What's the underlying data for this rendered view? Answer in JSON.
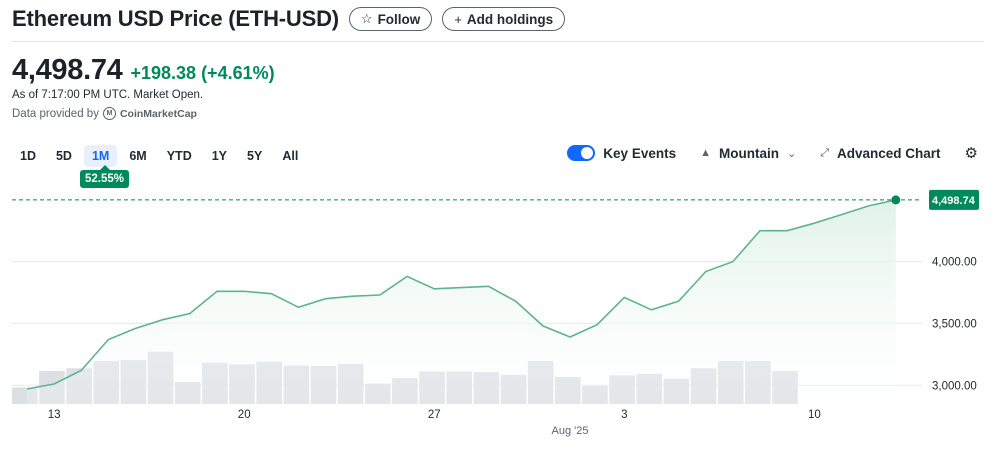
{
  "header": {
    "title": "Ethereum USD Price (ETH-USD)",
    "follow_label": "Follow",
    "add_holdings_label": "Add holdings"
  },
  "quote": {
    "price": "4,498.74",
    "change": "+198.38 (+4.61%)",
    "as_of": "As of 7:17:00 PM UTC. Market Open.",
    "provided_by": "Data provided by",
    "provider": "CoinMarketCap"
  },
  "ranges": [
    "1D",
    "5D",
    "1M",
    "6M",
    "YTD",
    "1Y",
    "5Y",
    "All"
  ],
  "active_range": "1M",
  "range_change_badge": "52.55%",
  "controls": {
    "key_events_label": "Key Events",
    "key_events_on": true,
    "chart_type_label": "Mountain",
    "advanced_label": "Advanced Chart"
  },
  "icons": {
    "follow": "star-outline-icon",
    "add": "plus-icon",
    "chart_type": "mountain-icon",
    "chevron": "chevron-down-icon",
    "advanced": "expand-arrows-icon",
    "settings": "gear-icon"
  },
  "colors": {
    "accent_green": "#008a5c",
    "line": "#5fb38f",
    "area_top": "#dff1e8",
    "volume_bar": "#dcdfe3",
    "toggle_blue": "#0f69ff"
  },
  "chart_data": {
    "type": "area",
    "y_ticks": [
      "3,000.00",
      "3,500.00",
      "4,000.00"
    ],
    "y_tick_values": [
      3000,
      3500,
      4000
    ],
    "ylim": [
      2800,
      4700
    ],
    "x_tick_labels": [
      "13",
      "20",
      "27",
      "Aug '25",
      "3",
      "10"
    ],
    "x_tick_index": [
      1,
      8,
      15,
      20,
      22,
      29
    ],
    "last_value_label": "4,498.74",
    "last_value": 4498.74,
    "baseline": 4498.74,
    "series": [
      {
        "values": [
          2970,
          3010,
          3120,
          3370,
          3460,
          3530,
          3580,
          3760,
          3760,
          3740,
          3630,
          3700,
          3720,
          3730,
          3880,
          3780,
          3790,
          3800,
          3680,
          3480,
          3390,
          3490,
          3710,
          3610,
          3680,
          3920,
          4000,
          4250,
          4250,
          4310,
          4380,
          4450,
          4498.74
        ]
      }
    ],
    "volume": {
      "values": [
        0.3,
        0.6,
        0.65,
        0.78,
        0.8,
        0.95,
        0.4,
        0.75,
        0.72,
        0.77,
        0.7,
        0.69,
        0.73,
        0.37,
        0.47,
        0.59,
        0.59,
        0.58,
        0.53,
        0.78,
        0.49,
        0.33,
        0.52,
        0.55,
        0.46,
        0.65,
        0.78,
        0.78,
        0.6
      ]
    }
  }
}
